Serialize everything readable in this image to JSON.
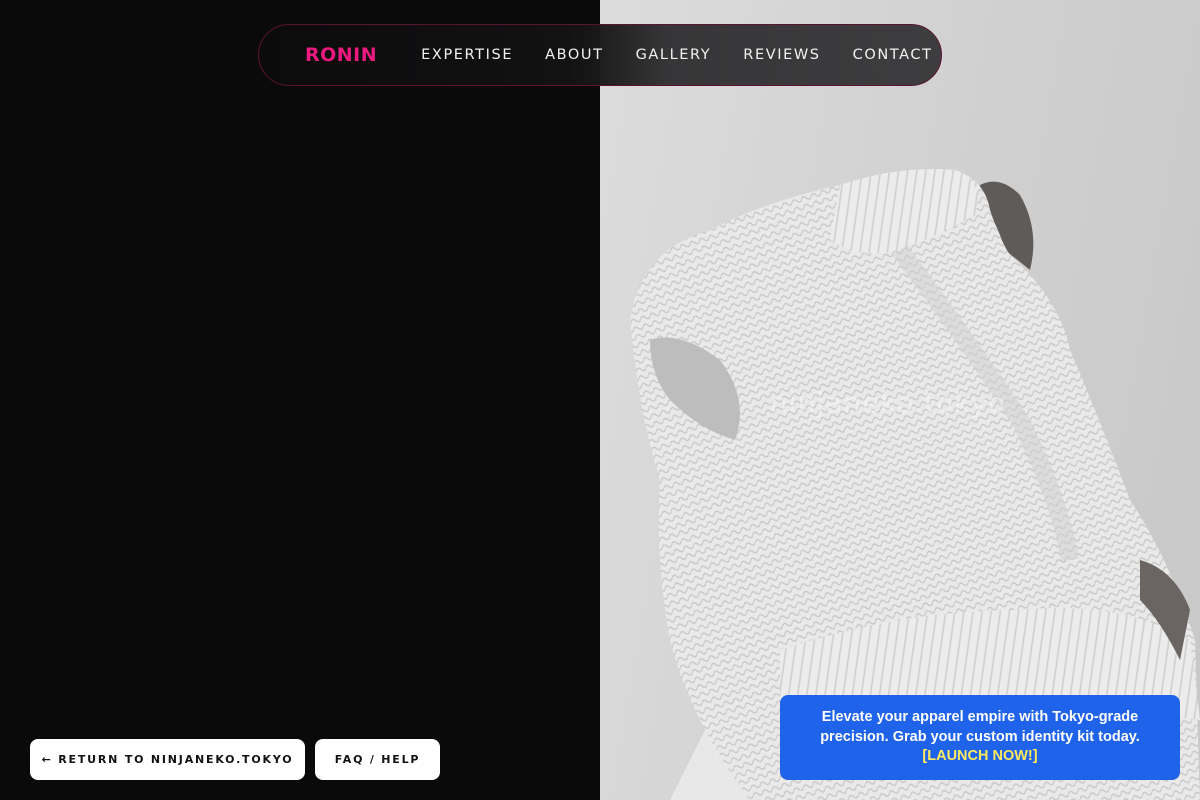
{
  "nav": {
    "brand": "RONIN",
    "links": [
      "EXPERTISE",
      "ABOUT",
      "GALLERY",
      "REVIEWS",
      "CONTACT"
    ]
  },
  "hero": {
    "watermark": "ninjaneko.tokyo",
    "image": "grayscale photo of a person pulling a white knit sweater over their head"
  },
  "buttons": {
    "return_label": "← RETURN TO NINJANEKO.TOKYO",
    "faq_label": "FAQ / HELP"
  },
  "promo": {
    "line1": "Elevate your apparel empire with Tokyo-grade",
    "line2": "precision. Grab your custom identity kit today.",
    "cta": "[LAUNCH NOW!]"
  },
  "colors": {
    "brand_pink": "#ec1a7f",
    "promo_blue": "#1f63ea",
    "promo_cta": "#ffe95c",
    "background": "#0a0a0b"
  }
}
